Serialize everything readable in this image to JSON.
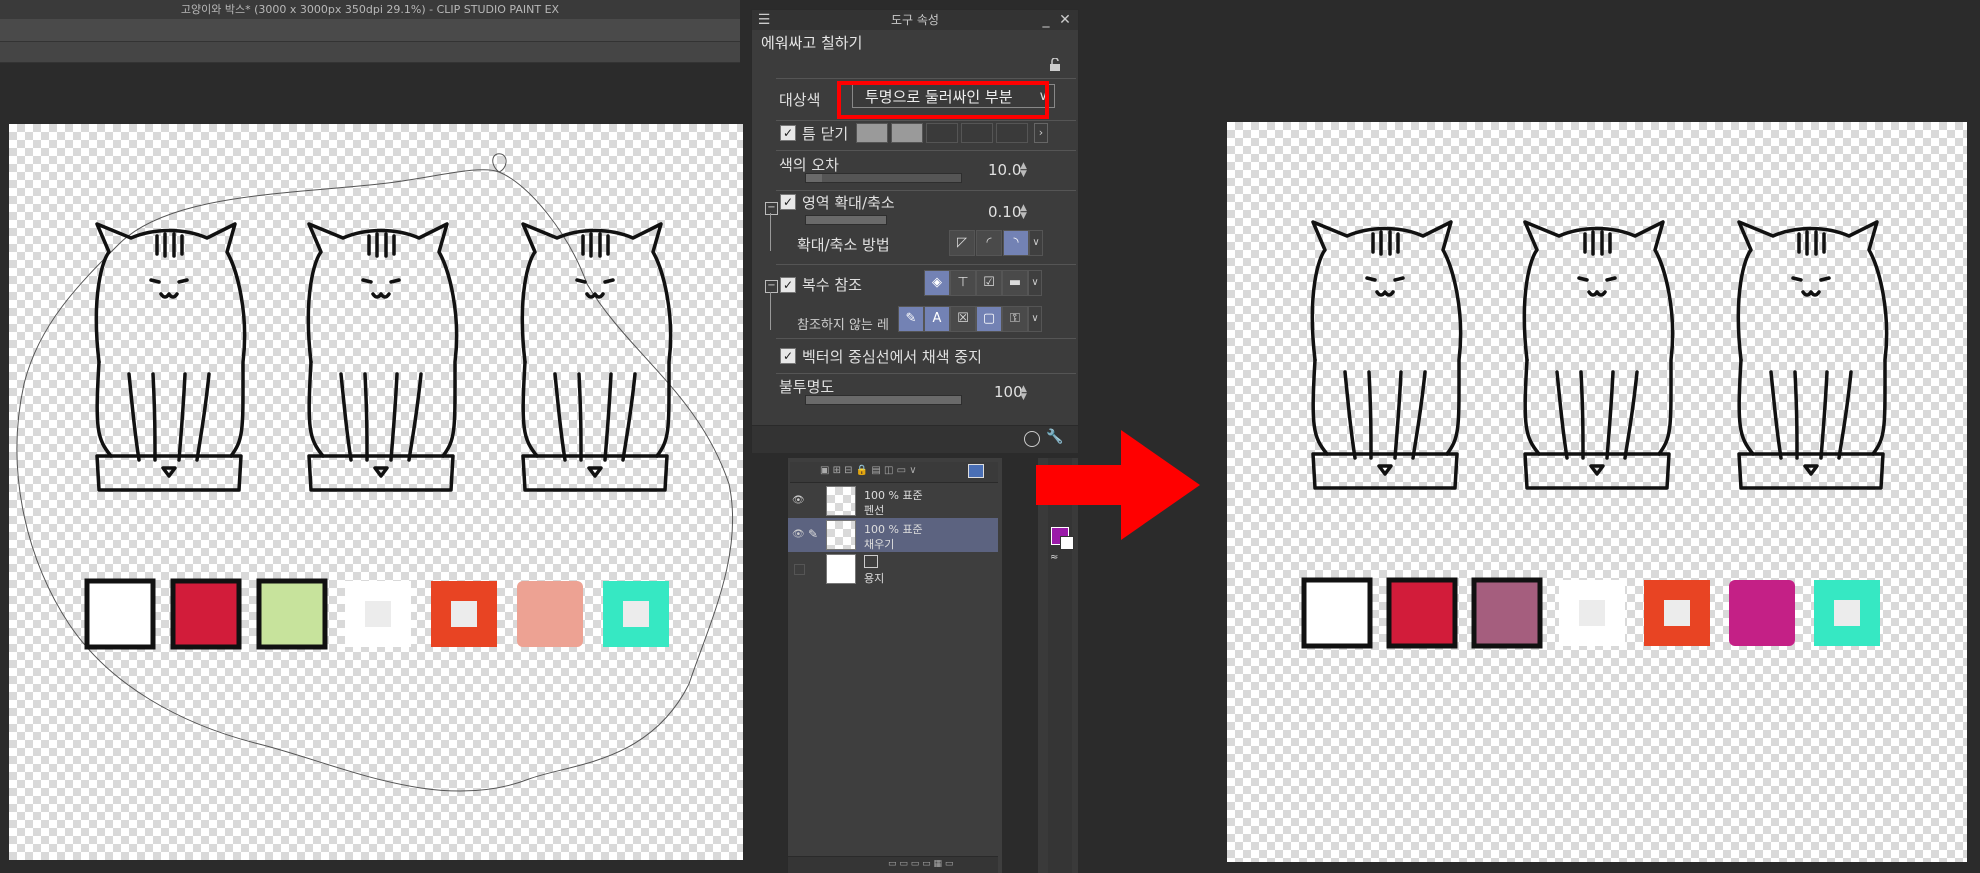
{
  "app": {
    "title": "고양이와 박스* (3000 x 3000px 350dpi 29.1%)  - CLIP STUDIO PAINT EX"
  },
  "tool_panel": {
    "header": "도구 속성",
    "tool_name": "에워싸고 칠하기",
    "target_color": {
      "label": "대상색",
      "value": "투명으로 둘러싸인 부분"
    },
    "close_gap": {
      "label": "틈 닫기",
      "checked": true
    },
    "color_margin": {
      "label": "색의 오차",
      "value": "10.0"
    },
    "area_scaling": {
      "label": "영역 확대/축소",
      "checked": true,
      "value": "0.10"
    },
    "scaling_method": {
      "label": "확대/축소 방법"
    },
    "multi_refer": {
      "label": "복수 참조",
      "checked": true
    },
    "exclude_layers": {
      "label": "참조하지 않는 레"
    },
    "vector_center": {
      "label": "벡터의 중심선에서 채색 중지",
      "checked": true
    },
    "opacity": {
      "label": "불투명도",
      "value": "100"
    }
  },
  "layers": [
    {
      "blend": "100 % 표준",
      "name": "펜선",
      "selected": false
    },
    {
      "blend": "100 % 표준",
      "name": "채우기",
      "selected": true
    },
    {
      "blend": "",
      "name": "용지",
      "selected": false
    }
  ],
  "colors": {
    "main_color": "#9a1aa8",
    "highlight": "#ff0000",
    "arrow": "#ff0000",
    "swatches_before": [
      "#ffffff",
      "#d21c3a",
      "#c7e39c",
      "#ffffff",
      "#e84423",
      "#eda293",
      "#36e8c3"
    ],
    "swatches_after": [
      "#ffffff",
      "#d21c3a",
      "#a55e7e",
      "#ffffff",
      "#e84423",
      "#c42086",
      "#36e8c3"
    ]
  }
}
